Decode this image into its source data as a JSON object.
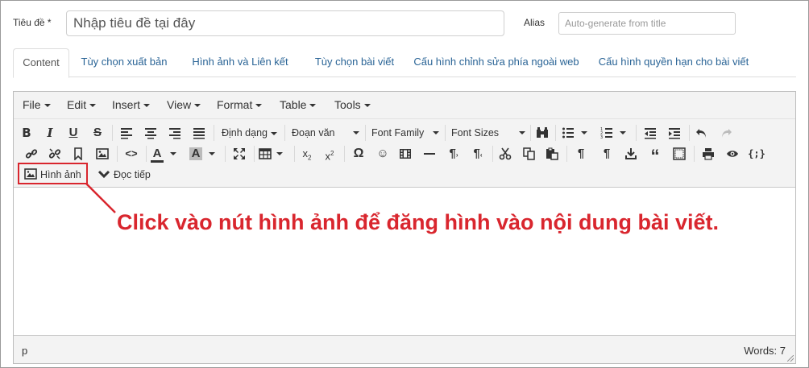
{
  "form": {
    "title_label": "Tiêu đề *",
    "title_value": "Nhập tiêu đề tại đây",
    "alias_label": "Alias",
    "alias_placeholder": "Auto-generate from title"
  },
  "tabs": [
    {
      "label": "Content",
      "active": true
    },
    {
      "label": "Tùy chọn xuất bản",
      "active": false
    },
    {
      "label": "Hình ảnh và Liên kết",
      "active": false
    },
    {
      "label": "Tùy chọn bài viết",
      "active": false
    },
    {
      "label": "Cấu hình chỉnh sửa phía ngoài web",
      "active": false
    },
    {
      "label": "Cấu hình quyền hạn cho bài viết",
      "active": false
    }
  ],
  "menubar": [
    "File",
    "Edit",
    "Insert",
    "View",
    "Format",
    "Table",
    "Tools"
  ],
  "toolbar": {
    "format_dropdown": "Định dạng",
    "paragraph_dropdown": "Đoạn văn",
    "font_family_dropdown": "Font Family",
    "font_sizes_dropdown": "Font Sizes",
    "image_button": "Hình ảnh",
    "readmore_button": "Đọc tiếp"
  },
  "status": {
    "path": "p",
    "words": "Words: 7"
  },
  "annotation": {
    "text": "Click vào nút hình ảnh để đăng hình vào nội dung bài viết.",
    "color": "#d9262e"
  },
  "colors": {
    "link": "#2a6496",
    "toolbar_bg": "#f3f3f3",
    "highlight": "#d9262e"
  }
}
